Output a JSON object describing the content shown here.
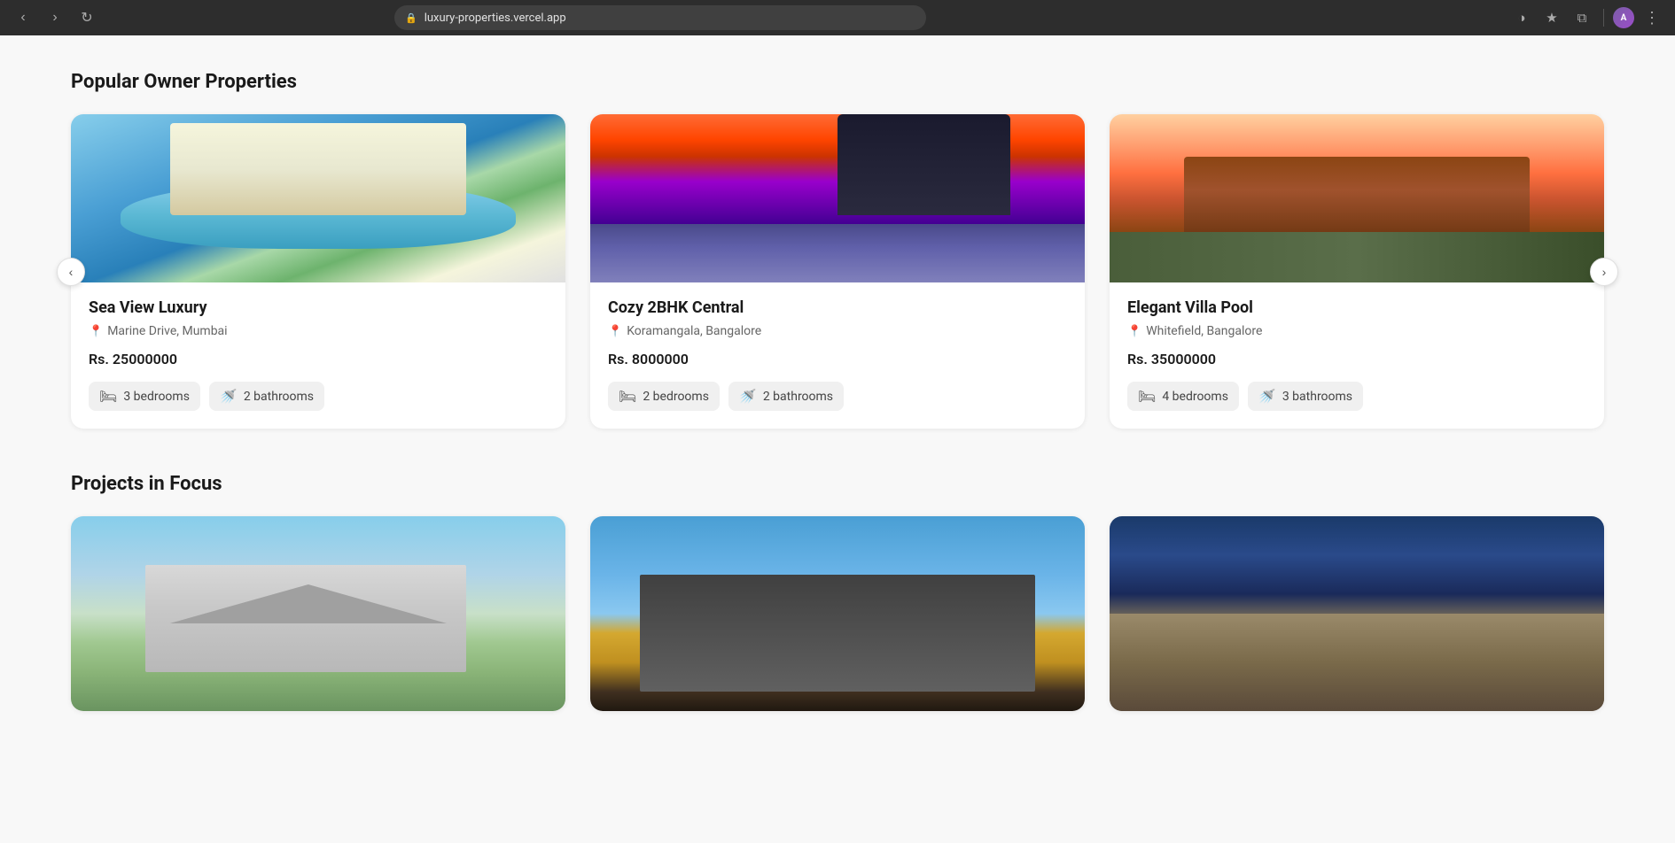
{
  "browser": {
    "url": "luxury-properties.vercel.app",
    "back_btn": "‹",
    "forward_btn": "›",
    "reload_btn": "↻"
  },
  "sections": {
    "popular": {
      "title": "Popular Owner Properties",
      "prev_label": "‹",
      "next_label": "›",
      "cards": [
        {
          "id": "sea-view-luxury",
          "title": "Sea View Luxury",
          "location": "Marine Drive, Mumbai",
          "price": "Rs. 25000000",
          "bedrooms": "3 bedrooms",
          "bathrooms": "2 bathrooms",
          "img_type": "pool-villa"
        },
        {
          "id": "cozy-2bhk-central",
          "title": "Cozy 2BHK Central",
          "location": "Koramangala, Bangalore",
          "price": "Rs. 8000000",
          "bedrooms": "2 bedrooms",
          "bathrooms": "2 bathrooms",
          "img_type": "sunset-pool"
        },
        {
          "id": "elegant-villa-pool",
          "title": "Elegant Villa Pool",
          "location": "Whitefield, Bangalore",
          "price": "Rs. 35000000",
          "bedrooms": "4 bedrooms",
          "bathrooms": "3 bathrooms",
          "img_type": "cabin"
        }
      ]
    },
    "projects": {
      "title": "Projects in Focus",
      "cards": [
        {
          "id": "farmhouse-project",
          "img_type": "farmhouse"
        },
        {
          "id": "modern-project",
          "img_type": "modern"
        },
        {
          "id": "stone-project",
          "img_type": "stone"
        }
      ]
    }
  },
  "icons": {
    "bed": "🛏",
    "bath": "🚿",
    "location_pin": "📍"
  }
}
